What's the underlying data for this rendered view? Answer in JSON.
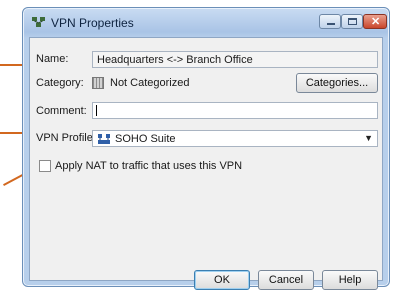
{
  "window": {
    "title": "VPN Properties",
    "icon": "vpn-properties-icon"
  },
  "form": {
    "name_label": "Name:",
    "name_value": "Headquarters <-> Branch Office",
    "category_label": "Category:",
    "category_value": "Not Categorized",
    "categories_button": "Categories...",
    "comment_label": "Comment:",
    "comment_value": "",
    "vpn_profile_label": "VPN Profile:",
    "vpn_profile_value": "SOHO Suite",
    "nat_checkbox_label": "Apply NAT to traffic that uses this VPN",
    "nat_checked": false
  },
  "buttons": {
    "ok": "OK",
    "cancel": "Cancel",
    "help": "Help"
  },
  "colors": {
    "callout": "#d2681f",
    "title_gradient_top": "#c9dcf2",
    "close_button": "#c9452b",
    "dialog_background": "#f0f0f0"
  }
}
